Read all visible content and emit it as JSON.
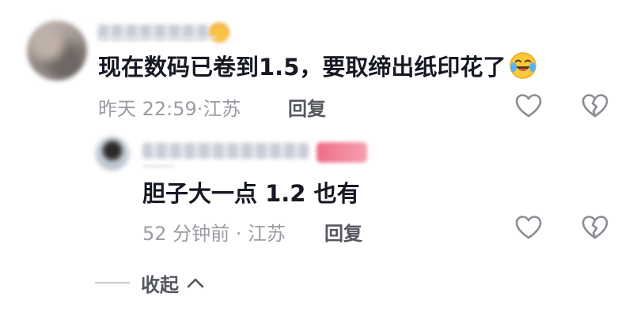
{
  "comment": {
    "text": "现在数码已卷到1.5，要取缔出纸印花了",
    "time": "昨天 22:59",
    "location": "江苏",
    "reply_label": "回复",
    "emoji": "rolling-on-floor-laughing-emoji"
  },
  "reply": {
    "text": "胆子大一点 1.2 也有",
    "time": "52 分钟前",
    "location": "江苏",
    "reply_label": "回复"
  },
  "collapse": {
    "label": "收起"
  },
  "colors": {
    "text": "#161823",
    "meta": "#9a9ca3",
    "action": "#55575f",
    "icon": "#8a8c93"
  }
}
